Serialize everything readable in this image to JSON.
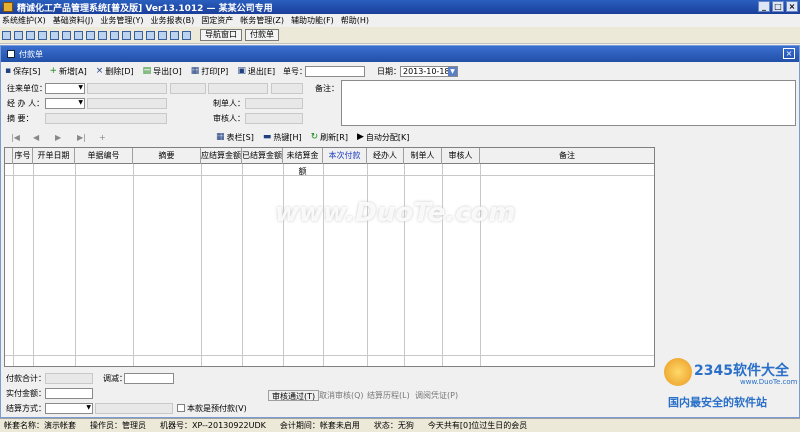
{
  "window": {
    "title": "精诚化工产品管理系统[普及版]  Ver13.1012  —  某某公司专用",
    "controls": [
      "_",
      "□",
      "×"
    ]
  },
  "menu": [
    "系统维护(X)",
    "基础资料(J)",
    "业务管理(Y)",
    "业务报表(B)",
    "固定资产",
    "帐务管理(Z)",
    "辅助功能(F)",
    "帮助(H)"
  ],
  "quick": {
    "nav_label": "导航窗口",
    "doc_label": "付款单"
  },
  "doc": {
    "title": "付款单",
    "close": "×"
  },
  "toolbar": {
    "save": "保存[S]",
    "add": "新增[A]",
    "delete": "删除[D]",
    "export": "导出[O]",
    "print": "打印[P]",
    "exit": "退出[E]"
  },
  "header": {
    "doc_no_label": "单号：",
    "doc_no": "",
    "date_label": "日期：",
    "date": "2013-10-18",
    "remark_label": "备注："
  },
  "form": {
    "partner_label": "往来单位：",
    "handler_label": "经 办 人：",
    "summary_label": "摘    要：",
    "maker_label": "制单人：",
    "auditor_label": "审核人："
  },
  "gridbar": {
    "nav": [
      "|◀",
      "◀",
      "▶",
      "▶|",
      "+"
    ],
    "columns_btn": "表栏[S]",
    "hotkey_btn": "热键[H]",
    "refresh_btn": "刷新[R]",
    "auto_btn": "自动分配[K]"
  },
  "grid": {
    "columns": [
      "序号",
      "开单日期",
      "单据编号",
      "摘要",
      "应结算金额",
      "已结算金额",
      "未结算金额",
      "本次付款",
      "经办人",
      "制单人",
      "审核人",
      "备注"
    ],
    "highlight_column": "本次付款",
    "highlight_color": "#2040c0"
  },
  "footer": {
    "total_label": "付款合计：",
    "adjust_label": "调减：",
    "actual_label": "实付金额：",
    "method_label": "结算方式：",
    "prepay_label": "本款是预付款(V)",
    "audit_pass": "审核通过(T)",
    "cancel_audit": "取消审核(Q)",
    "settle_history": "结算历程(L)",
    "adjust_voucher": "调阅凭证(P)"
  },
  "status": [
    "帐套名称：演示帐套",
    "操作员：管理员",
    "机器号：XP--20130922UDK",
    "会计期间：帐套未启用",
    "状态：无狗",
    "今天共有[0]位过生日的会员"
  ],
  "watermark": {
    "main": "www.DuoTe.com",
    "brand": "2345软件大全",
    "site": "www.DuoTe.com",
    "tagline": "国内最安全的软件站"
  }
}
